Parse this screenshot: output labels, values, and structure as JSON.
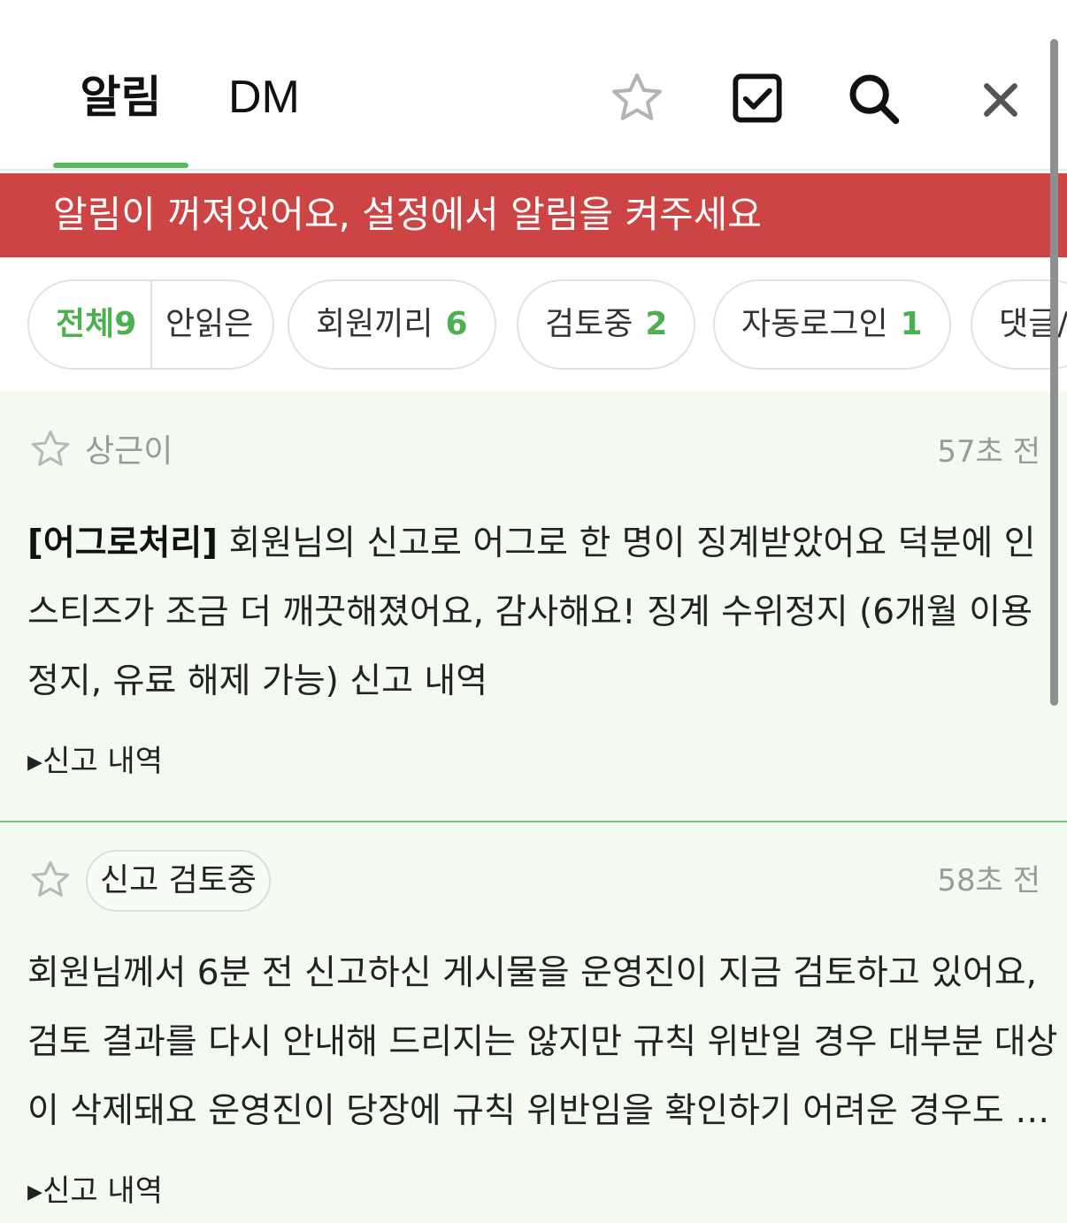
{
  "header": {
    "tabs": [
      {
        "label": "알림",
        "active": true
      },
      {
        "label": "DM",
        "active": false
      }
    ],
    "icons": [
      "star-outline-icon",
      "checkbox-icon",
      "search-icon",
      "close-icon"
    ]
  },
  "banner": {
    "text": "알림이 꺼져있어요, 설정에서 알림을 켜주세요",
    "color": "#cc4444"
  },
  "filters": {
    "all": {
      "label": "전체",
      "count": "9"
    },
    "unread_label": "안읽은",
    "chips": [
      {
        "label": "회원끼리",
        "count": "6"
      },
      {
        "label": "검토중",
        "count": "2"
      },
      {
        "label": "자동로그인",
        "count": "1"
      },
      {
        "label": "댓글/",
        "count": ""
      }
    ],
    "accent": "#4caf50"
  },
  "notifications": [
    {
      "sender": "상근이",
      "time": "57초 전",
      "tag": "[어그로처리]",
      "message": "회원님의 신고로 어그로 한 명이 징계받았어요 덕분에 인스티즈가 조금 더 깨끗해졌어요, 감사해요! 징계 수위정지 (6개월 이용 정지, 유료 해제 가능) 신고 내역",
      "link": "▸신고 내역"
    },
    {
      "status": "신고 검토중",
      "time": "58초 전",
      "message": "회원님께서 6분 전 신고하신 게시물을 운영진이 지금 검토하고 있어요, 검토 결과를 다시 안내해 드리지는 않지만 규칙 위반일 경우 대부분 대상이 삭제돼요 운영진이 당장에 규칙 위반임을 확인하기 어려운 경우도 있어요",
      "link": "▸신고 내역"
    }
  ],
  "colors": {
    "card_bg": "#f3fbf1",
    "separator": "#7cc47e"
  }
}
